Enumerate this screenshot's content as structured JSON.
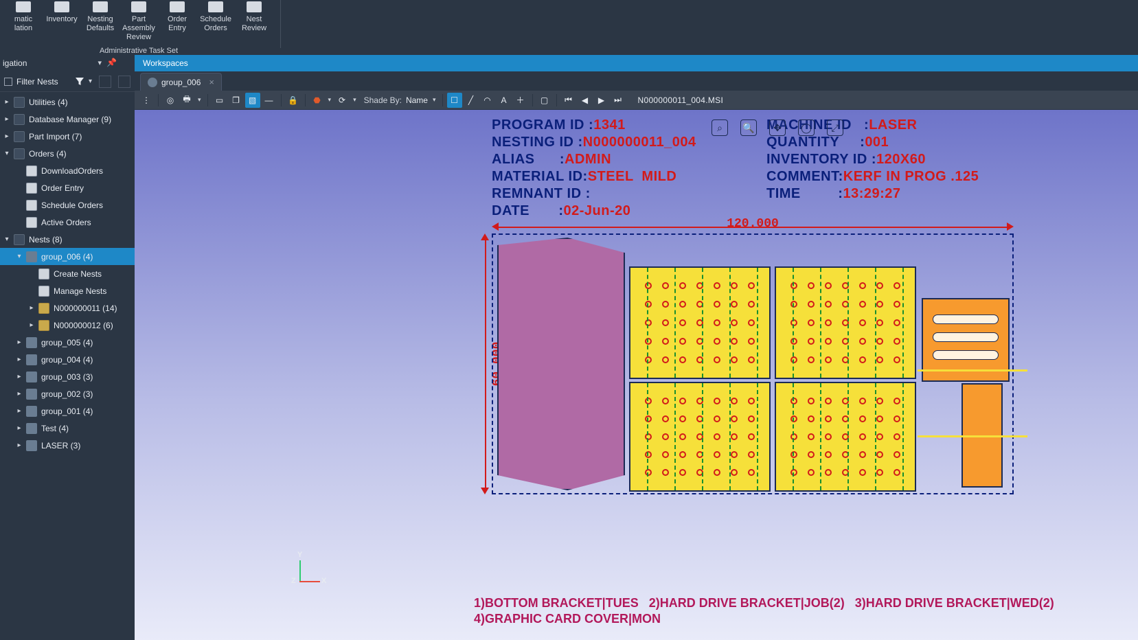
{
  "ribbon": {
    "buttons": [
      {
        "label": "matic\nlation"
      },
      {
        "label": "Inventory"
      },
      {
        "label": "Nesting\nDefaults"
      },
      {
        "label": "Part\nAssembly Review"
      },
      {
        "label": "Order\nEntry"
      },
      {
        "label": "Schedule\nOrders"
      },
      {
        "label": "Nest\nReview"
      }
    ],
    "group_caption": "Administrative Task Set"
  },
  "nav": {
    "left": "igation",
    "right": "Workspaces"
  },
  "filter": {
    "label": "Filter Nests"
  },
  "tree": [
    {
      "depth": 0,
      "exp": "▸",
      "ico": "db",
      "label": "Utilities (4)"
    },
    {
      "depth": 0,
      "exp": "▸",
      "ico": "db",
      "label": "Database Manager (9)"
    },
    {
      "depth": 0,
      "exp": "▸",
      "ico": "db",
      "label": "Part Import (7)"
    },
    {
      "depth": 0,
      "exp": "▾",
      "ico": "db",
      "label": "Orders (4)"
    },
    {
      "depth": 1,
      "exp": "",
      "ico": "page",
      "label": "DownloadOrders"
    },
    {
      "depth": 1,
      "exp": "",
      "ico": "page",
      "label": "Order Entry"
    },
    {
      "depth": 1,
      "exp": "",
      "ico": "page",
      "label": "Schedule Orders"
    },
    {
      "depth": 1,
      "exp": "",
      "ico": "page",
      "label": "Active Orders"
    },
    {
      "depth": 0,
      "exp": "▾",
      "ico": "db",
      "label": "Nests (8)"
    },
    {
      "depth": 1,
      "exp": "▾",
      "ico": "group",
      "label": "group_006 (4)",
      "selected": true
    },
    {
      "depth": 2,
      "exp": "",
      "ico": "page",
      "label": "Create Nests"
    },
    {
      "depth": 2,
      "exp": "",
      "ico": "page",
      "label": "Manage Nests"
    },
    {
      "depth": 2,
      "exp": "▸",
      "ico": "fold",
      "label": "N000000011 (14)"
    },
    {
      "depth": 2,
      "exp": "▸",
      "ico": "fold",
      "label": "N000000012 (6)"
    },
    {
      "depth": 1,
      "exp": "▸",
      "ico": "group",
      "label": "group_005 (4)"
    },
    {
      "depth": 1,
      "exp": "▸",
      "ico": "group",
      "label": "group_004 (4)"
    },
    {
      "depth": 1,
      "exp": "▸",
      "ico": "group",
      "label": "group_003 (3)"
    },
    {
      "depth": 1,
      "exp": "▸",
      "ico": "group",
      "label": "group_002 (3)"
    },
    {
      "depth": 1,
      "exp": "▸",
      "ico": "group",
      "label": "group_001 (4)"
    },
    {
      "depth": 1,
      "exp": "▸",
      "ico": "group",
      "label": "Test (4)"
    },
    {
      "depth": 1,
      "exp": "▸",
      "ico": "group",
      "label": "LASER (3)"
    }
  ],
  "tab": {
    "label": "group_006"
  },
  "toolbar": {
    "shade_by_label": "Shade By:",
    "shade_by_value": "Name",
    "doc_name": "N000000011_004.MSI"
  },
  "header_left": [
    {
      "k": "PROGRAM ID :",
      "v": "1341"
    },
    {
      "k": "NESTING ID :",
      "v": "N000000011_004"
    },
    {
      "k": "ALIAS      :",
      "v": "ADMIN"
    },
    {
      "k": "MATERIAL ID:",
      "v": "STEEL  MILD"
    },
    {
      "k": "REMNANT ID :",
      "v": ""
    },
    {
      "k": "DATE       :",
      "v": "02-Jun-20"
    }
  ],
  "header_right": [
    {
      "k": "MACHINE ID   :",
      "v": "LASER"
    },
    {
      "k": "",
      "v": ""
    },
    {
      "k": "QUANTITY     :",
      "v": "001"
    },
    {
      "k": "INVENTORY ID :",
      "v": "120X60"
    },
    {
      "k": "COMMENT:",
      "v": "KERF IN PROG .125"
    },
    {
      "k": "TIME         :",
      "v": "13:29:27"
    }
  ],
  "dims": {
    "width": "120.000",
    "height": "60.000"
  },
  "axis": {
    "x": "X",
    "y": "Y",
    "z": "Z"
  },
  "partlist": {
    "line1": "1)BOTTOM BRACKET|TUES   2)HARD DRIVE BRACKET|JOB(2)   3)HARD DRIVE BRACKET|WED(2)",
    "line2": "4)GRAPHIC CARD COVER|MON"
  },
  "chart_data": {
    "type": "nest-layout",
    "sheet": {
      "width": 120.0,
      "height": 60.0,
      "material": "STEEL MILD",
      "inventory_id": "120X60"
    },
    "parts": [
      {
        "idx": 1,
        "name": "BOTTOM BRACKET",
        "job": "TUES",
        "qty": 1,
        "color": "#b06aa5"
      },
      {
        "idx": 2,
        "name": "HARD DRIVE BRACKET",
        "job": "JOB",
        "qty": 2,
        "color": "#f6e03a"
      },
      {
        "idx": 3,
        "name": "HARD DRIVE BRACKET",
        "job": "WED",
        "qty": 2,
        "color": "#f6e03a"
      },
      {
        "idx": 4,
        "name": "GRAPHIC CARD COVER",
        "job": "MON",
        "qty": 1,
        "color": "#f79a2e"
      }
    ]
  }
}
